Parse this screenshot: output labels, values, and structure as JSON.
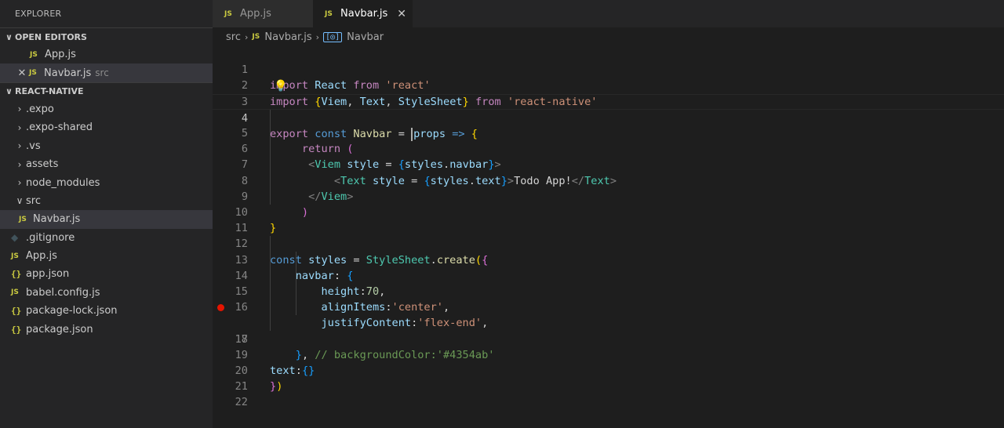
{
  "sidebar": {
    "title": "EXPLORER",
    "open_editors": {
      "header": "OPEN EDITORS",
      "items": [
        {
          "label": "App.js",
          "path": ""
        },
        {
          "label": "Navbar.js",
          "path": "src"
        }
      ]
    },
    "project": {
      "header": "REACT-NATIVE",
      "items": [
        {
          "label": ".expo",
          "kind": "folder"
        },
        {
          "label": ".expo-shared",
          "kind": "folder"
        },
        {
          "label": ".vs",
          "kind": "folder"
        },
        {
          "label": "assets",
          "kind": "folder"
        },
        {
          "label": "node_modules",
          "kind": "folder"
        },
        {
          "label": "src",
          "kind": "folder-open"
        },
        {
          "label": "Navbar.js",
          "kind": "js"
        },
        {
          "label": ".gitignore",
          "kind": "git"
        },
        {
          "label": "App.js",
          "kind": "js"
        },
        {
          "label": "app.json",
          "kind": "json"
        },
        {
          "label": "babel.config.js",
          "kind": "js"
        },
        {
          "label": "package-lock.json",
          "kind": "json"
        },
        {
          "label": "package.json",
          "kind": "json"
        }
      ]
    }
  },
  "tabs": [
    {
      "label": "App.js",
      "active": false
    },
    {
      "label": "Navbar.js",
      "active": true
    }
  ],
  "breadcrumb": {
    "folder": "src",
    "file": "Navbar.js",
    "symbol": "Navbar"
  },
  "badges": {
    "js": "JS",
    "json": "{}",
    "close": "✕",
    "chev_down": "∨",
    "chev_right": "›"
  },
  "colors": {
    "breakpoint": "#e51400",
    "accent": "#007acc",
    "js_badge": "#cbcb41"
  },
  "editor": {
    "line_numbers": [
      "1",
      "2",
      "3",
      "4",
      "5",
      "6",
      "7",
      "8",
      "9",
      "10",
      "11",
      "12",
      "13",
      "14",
      "15",
      "16",
      "17",
      "18",
      "19",
      "20",
      "21",
      "22"
    ],
    "lines": [
      "import React from 'react'",
      "import {Viem, Text, StyleSheet} from 'react-native'",
      "",
      "export const Navbar = props => {",
      "return (",
      "<Viem style = {styles.navbar}>",
      "<Text style = {styles.text}>Todo App!</Text>",
      "</Viem>",
      ")",
      "}",
      "",
      "const styles = StyleSheet.create({",
      "navbar: {",
      "height:70,",
      "alignItems:'center',",
      "justifyContent:'flex-end',",
      "// backgroundColor:'#4354ab'",
      "},",
      "text:{}",
      "})",
      "",
      ""
    ],
    "breakpoint_line": "17",
    "current_line": "4"
  }
}
